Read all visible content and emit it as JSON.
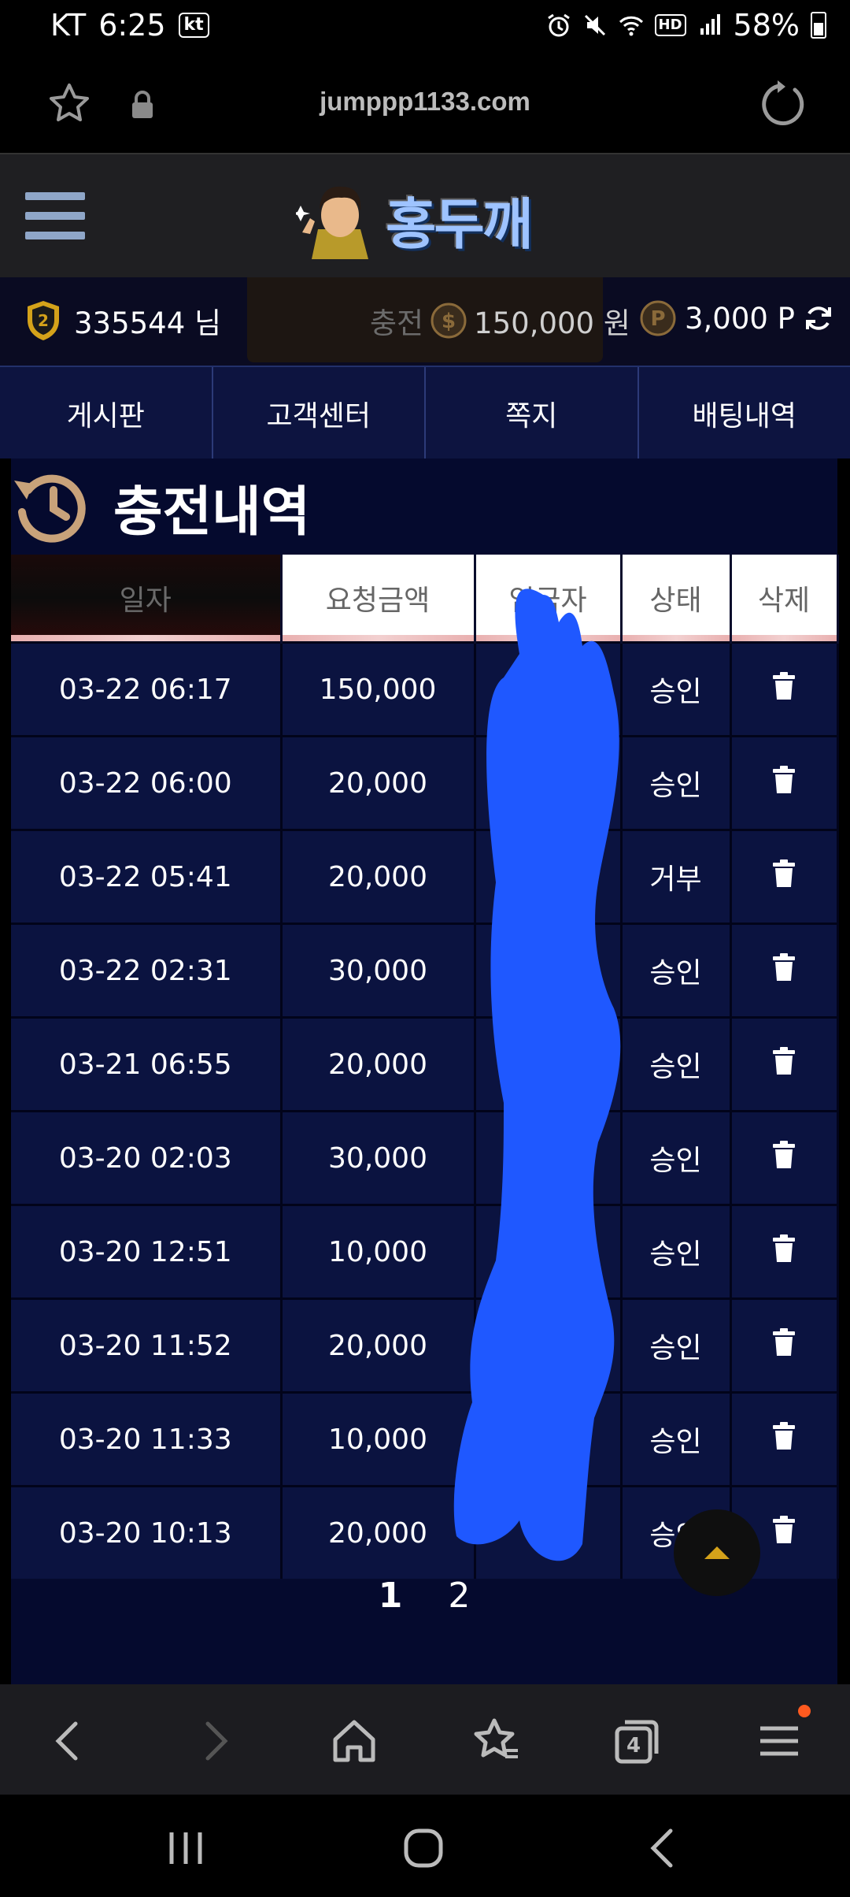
{
  "status_bar": {
    "carrier": "KT",
    "time": "6:25",
    "carrier_badge": "kt",
    "hd": "HD",
    "battery": "58%"
  },
  "browser": {
    "url": "jumppp1133.com"
  },
  "site": {
    "logo_text": "홍두깨"
  },
  "info_bar": {
    "username": "335544 님",
    "level": "2",
    "balance_label": "충전",
    "balance_value": "150,000 원",
    "points": "3,000 P"
  },
  "nav": [
    "게시판",
    "고객센터",
    "쪽지",
    "배팅내역"
  ],
  "page": {
    "title": "충전내역"
  },
  "table": {
    "headers": [
      "일자",
      "요청금액",
      "입금자",
      "상태",
      "삭제"
    ],
    "rows": [
      {
        "date": "03-22 06:17",
        "amount": "150,000",
        "status": "승인"
      },
      {
        "date": "03-22 06:00",
        "amount": "20,000",
        "status": "승인"
      },
      {
        "date": "03-22 05:41",
        "amount": "20,000",
        "status": "거부"
      },
      {
        "date": "03-22 02:31",
        "amount": "30,000",
        "status": "승인"
      },
      {
        "date": "03-21 06:55",
        "amount": "20,000",
        "status": "승인"
      },
      {
        "date": "03-20 02:03",
        "amount": "30,000",
        "status": "승인"
      },
      {
        "date": "03-20 12:51",
        "amount": "10,000",
        "status": "승인"
      },
      {
        "date": "03-20 11:52",
        "amount": "20,000",
        "status": "승인"
      },
      {
        "date": "03-20 11:33",
        "amount": "10,000",
        "status": "승인"
      },
      {
        "date": "03-20 10:13",
        "amount": "20,000",
        "status": "승인"
      }
    ]
  },
  "pagination": [
    "1",
    "2"
  ],
  "toolbar": {
    "tab_count": "4"
  },
  "colors": {
    "nav_bg": "#0d1440",
    "row_bg": "#0b1340",
    "scribble": "#1f58ff",
    "menu_dot": "#ff5a1f"
  }
}
